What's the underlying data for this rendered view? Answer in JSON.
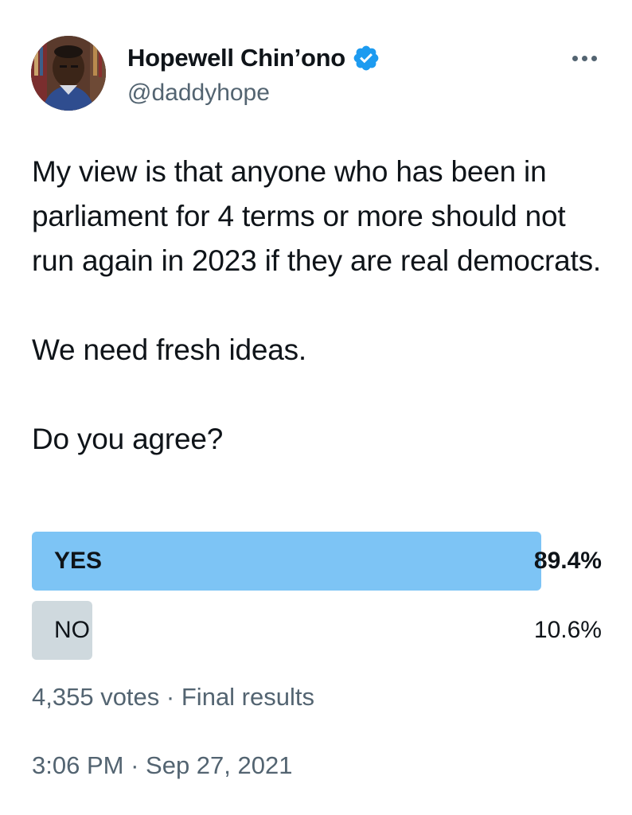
{
  "author": {
    "display_name": "Hopewell Chin’ono",
    "handle": "@daddyhope",
    "verified": true
  },
  "menu": {
    "more_icon": "more-horizontal-icon"
  },
  "tweet": {
    "paragraphs": [
      "My view is that anyone who has been in parliament for 4 terms or more should not run again in 2023 if they are real democrats.",
      "We need fresh ideas.",
      "Do you agree?"
    ]
  },
  "poll": {
    "options": [
      {
        "label": "YES",
        "percent_text": "89.4%",
        "percent": 89.4,
        "winner": true
      },
      {
        "label": "NO",
        "percent_text": "10.6%",
        "percent": 10.6,
        "winner": false
      }
    ],
    "votes": "4,355 votes",
    "separator": "·",
    "status": "Final results"
  },
  "timestamp": {
    "time": "3:06 PM",
    "separator": "·",
    "date": "Sep 27, 2021"
  },
  "colors": {
    "winner_fill": "#7dc4f5",
    "loser_fill": "#cfd9de",
    "verified_badge": "#1d9bf0",
    "secondary_text": "#536471",
    "primary_text": "#0f1419"
  }
}
